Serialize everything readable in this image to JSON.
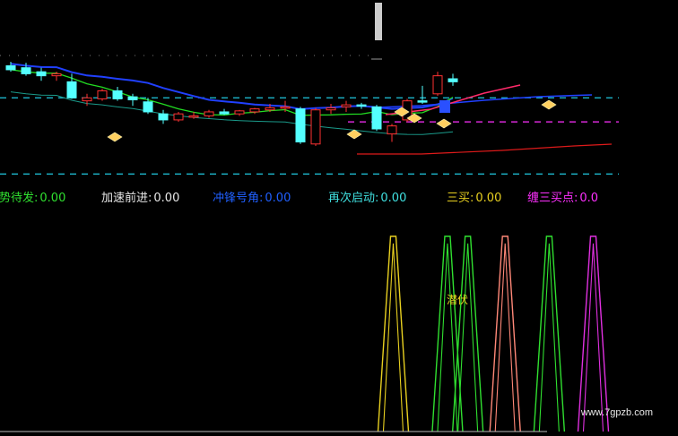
{
  "colors": {
    "background": "#000000",
    "up_candle": "#ff3232",
    "down_candle": "#54ffff",
    "ma_blue": "#2040ff",
    "ma_green": "#22dd22",
    "ma_teal": "#1a9a8a",
    "ma_red": "#dd1a1a",
    "dash_cyan": "#20c8e0",
    "dash_magenta": "#ff30ff",
    "signal_gold": "#ffd060",
    "yellow": "#e8d020",
    "green": "#30e030",
    "salmon": "#ff8878",
    "magenta": "#e030e0"
  },
  "legend": [
    {
      "label": "趋势待发:",
      "value": "0.00",
      "color": "#30e030"
    },
    {
      "label": "加速前进:",
      "value": "0.00",
      "color": "#e8e8e8"
    },
    {
      "label": "冲锋号角:",
      "value": "0.00",
      "color": "#2060ff"
    },
    {
      "label": "再次启动:",
      "value": "0.00",
      "color": "#40e0e0"
    },
    {
      "label": "三买:",
      "value": "0.00",
      "color": "#e8d020"
    },
    {
      "label": "缠三买点:",
      "value": "0.0",
      "color": "#ff30ff"
    }
  ],
  "annotation": "潜伏",
  "watermark": "www.7gpzb.com",
  "chart_data": [
    {
      "type": "candlestick",
      "title": "",
      "xlabel": "",
      "ylabel": "",
      "ylim": [
        0,
        100
      ],
      "grid": false,
      "candles": [
        {
          "o": 68,
          "h": 72,
          "l": 62,
          "c": 64
        },
        {
          "o": 66,
          "h": 71,
          "l": 58,
          "c": 60
        },
        {
          "o": 62,
          "h": 66,
          "l": 53,
          "c": 58
        },
        {
          "o": 58,
          "h": 62,
          "l": 53,
          "c": 60
        },
        {
          "o": 52,
          "h": 60,
          "l": 35,
          "c": 36
        },
        {
          "o": 33,
          "h": 40,
          "l": 28,
          "c": 36
        },
        {
          "o": 35,
          "h": 45,
          "l": 33,
          "c": 43
        },
        {
          "o": 43,
          "h": 47,
          "l": 33,
          "c": 35
        },
        {
          "o": 37,
          "h": 40,
          "l": 28,
          "c": 34
        },
        {
          "o": 32,
          "h": 36,
          "l": 20,
          "c": 22
        },
        {
          "o": 20,
          "h": 24,
          "l": 10,
          "c": 14
        },
        {
          "o": 14,
          "h": 22,
          "l": 12,
          "c": 20
        },
        {
          "o": 17,
          "h": 22,
          "l": 15,
          "c": 18
        },
        {
          "o": 18,
          "h": 24,
          "l": 16,
          "c": 22
        },
        {
          "o": 22,
          "h": 25,
          "l": 19,
          "c": 20
        },
        {
          "o": 20,
          "h": 24,
          "l": 18,
          "c": 23
        },
        {
          "o": 22,
          "h": 26,
          "l": 20,
          "c": 25
        },
        {
          "o": 24,
          "h": 30,
          "l": 22,
          "c": 26
        },
        {
          "o": 26,
          "h": 33,
          "l": 22,
          "c": 27
        },
        {
          "o": 25,
          "h": 27,
          "l": -10,
          "c": -8
        },
        {
          "o": -10,
          "h": 26,
          "l": -12,
          "c": 24
        },
        {
          "o": 24,
          "h": 30,
          "l": 20,
          "c": 26
        },
        {
          "o": 27,
          "h": 33,
          "l": 22,
          "c": 29
        },
        {
          "o": 29,
          "h": 31,
          "l": 25,
          "c": 28
        },
        {
          "o": 27,
          "h": 29,
          "l": 3,
          "c": 5
        },
        {
          "o": 0,
          "h": 10,
          "l": -8,
          "c": 8
        },
        {
          "o": 14,
          "h": 35,
          "l": 12,
          "c": 33
        },
        {
          "o": 33,
          "h": 48,
          "l": 30,
          "c": 32
        },
        {
          "o": 40,
          "h": 62,
          "l": 38,
          "c": 58
        },
        {
          "o": 55,
          "h": 60,
          "l": 48,
          "c": 52
        }
      ],
      "x_categories_count": 30,
      "reference_levels": [
        {
          "value": 36,
          "color": "#20c8e0"
        },
        {
          "value": 12,
          "color": "#ff30ff"
        },
        {
          "value": -40,
          "color": "#20c8e0"
        }
      ]
    },
    {
      "type": "line",
      "title": "",
      "note": "Sub-indicator pane with spike signals",
      "ylim": [
        0,
        100
      ],
      "series": [
        {
          "color": "#e8d020",
          "spikes_at": [
            0.58
          ]
        },
        {
          "color": "#30e030",
          "spikes_at": [
            0.66,
            0.69,
            0.81
          ]
        },
        {
          "color": "#ff8878",
          "spikes_at": [
            0.745
          ]
        },
        {
          "color": "#e030e0",
          "spikes_at": [
            0.875
          ]
        }
      ]
    }
  ]
}
